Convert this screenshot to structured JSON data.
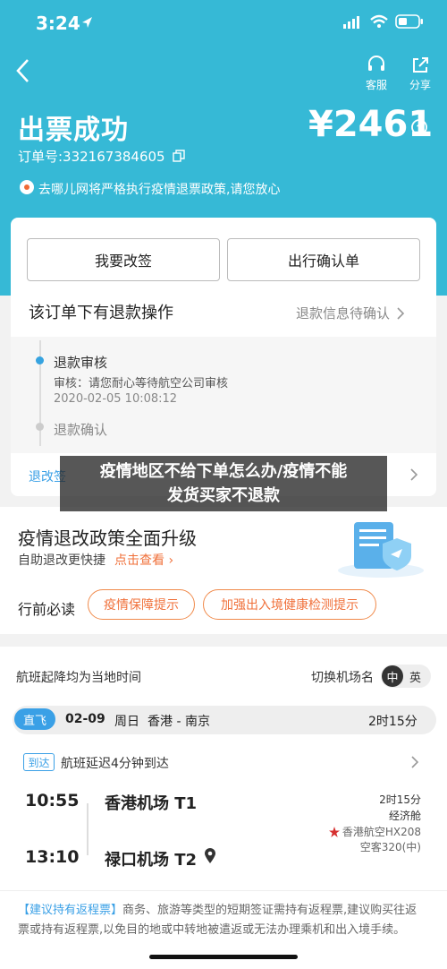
{
  "status_bar": {
    "time": "3:24"
  },
  "header": {
    "service_label": "客服",
    "share_label": "分享"
  },
  "ticket": {
    "title": "出票成功",
    "price": "¥2461",
    "order_label": "订单号:332167384605",
    "notice": "去哪儿网将严格执行疫情退票政策,请您放心"
  },
  "actions": {
    "change_label": "我要改签",
    "confirm_label": "出行确认单"
  },
  "refund": {
    "heading": "该订单下有退款操作",
    "status_link": "退款信息待确认",
    "step1_title": "退款审核",
    "step1_detail": "审核：请您耐心等待航空公司审核",
    "step1_time": "2020-02-05 10:08:12",
    "step2_title": "退款确认",
    "footer_link": "退改签"
  },
  "overlay": {
    "line1": "疫情地区不给下单怎么办/疫情不能",
    "line2": "发货买家不退款"
  },
  "policy": {
    "title": "疫情退改政策全面升级",
    "subtitle": "自助退改更快捷",
    "link": "点击查看",
    "must_read_label": "行前必读",
    "tip1": "疫情保障提示",
    "tip2": "加强出入境健康检测提示"
  },
  "flight": {
    "time_note": "航班起降均为当地时间",
    "switch_label": "切换机场名",
    "lang_zh": "中",
    "lang_en": "英",
    "direct_badge": "直飞",
    "date": "02-09",
    "weekday": "周日",
    "route": "香港 - 南京",
    "duration": "2时15分",
    "arrive_badge": "到达",
    "delay_note": "航班延迟4分钟到达",
    "dep_time": "10:55",
    "dep_airport": "香港机场 T1",
    "arr_time": "13:10",
    "arr_airport": "禄口机场 T2",
    "duration_small": "2时15分",
    "cabin": "经济舱",
    "airline": "香港航空HX208",
    "aircraft": "空客320(中)"
  },
  "advice": {
    "label": "【建议持有返程票】",
    "text": "商务、旅游等类型的短期签证需持有返程票,建议购买往返票或持有返程票,以免目的地或中转地被遣返或无法办理乘机和出入境手续。"
  },
  "colors": {
    "brand": "#36b9d6",
    "accent": "#f0703a",
    "badge_blue": "#3aa0e6"
  }
}
